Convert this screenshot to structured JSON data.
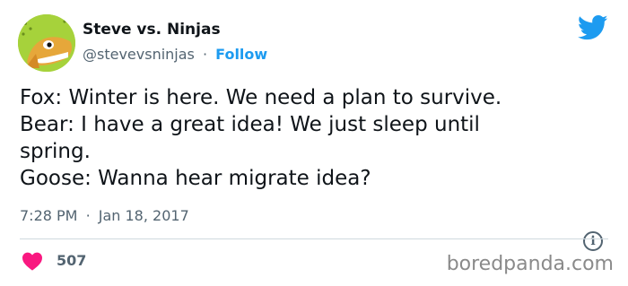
{
  "user": {
    "name": "Steve vs. Ninjas",
    "handle": "@stevevsninjas",
    "separator": "·",
    "follow_label": "Follow",
    "avatar_icon": "fish-avatar"
  },
  "brand_icon": "twitter-bird-icon",
  "tweet": {
    "lines": [
      "Fox: Winter is here. We need a plan to survive.",
      "Bear: I have a great idea! We just sleep until",
      "spring.",
      "Goose: Wanna hear migrate idea?"
    ],
    "time": "7:28 PM",
    "separator": "·",
    "date": "Jan 18, 2017"
  },
  "engagement": {
    "likes": "507",
    "like_icon": "heart-icon",
    "info_icon": "info-icon"
  },
  "watermark": "boredpanda.com",
  "colors": {
    "accent": "#1d9bf0",
    "heart": "#f91880",
    "text": "#0f1419",
    "muted": "#536471"
  }
}
